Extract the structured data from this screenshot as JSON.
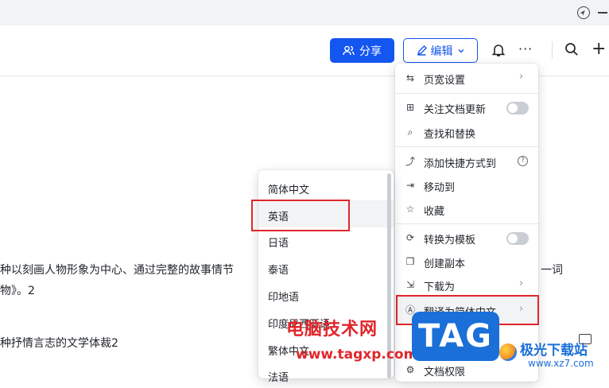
{
  "header": {
    "share_label": "分享",
    "edit_label": "编辑"
  },
  "doc": {
    "lines": [
      "种以刻画人物形象为中心、通过完整的故事情节",
      "物》。2",
      "种抒情言志的文学体裁2",
      "一词"
    ]
  },
  "menu": {
    "items": [
      {
        "label": "页宽设置",
        "icon": "page-width-icon"
      },
      {
        "label": "关注文档更新",
        "icon": "follow-icon"
      },
      {
        "label": "查找和替换",
        "icon": "find-replace-icon"
      },
      {
        "label": "添加快捷方式到",
        "icon": "shortcut-icon"
      },
      {
        "label": "移动到",
        "icon": "move-icon"
      },
      {
        "label": "收藏",
        "icon": "star-icon"
      },
      {
        "label": "转换为模板",
        "icon": "template-icon"
      },
      {
        "label": "创建副本",
        "icon": "copy-icon"
      },
      {
        "label": "下载为",
        "icon": "download-icon"
      },
      {
        "label": "翻译为简体中文",
        "icon": "translate-icon"
      },
      {
        "label": "文档权限",
        "icon": "permission-icon"
      }
    ]
  },
  "submenu": {
    "items": [
      "简体中文",
      "英语",
      "日语",
      "泰语",
      "印地语",
      "印度尼西亚语",
      "繁体中文",
      "法语"
    ],
    "selected_index": 1
  },
  "watermark": {
    "site_name": "电脑技术网",
    "site_url": "www.tagxp.com",
    "logo_text": "TAG",
    "right_name": "极光下载站",
    "right_url": "www.xz7.com"
  },
  "colors": {
    "accent": "#1456f0",
    "highlight_red": "#e0262b"
  }
}
